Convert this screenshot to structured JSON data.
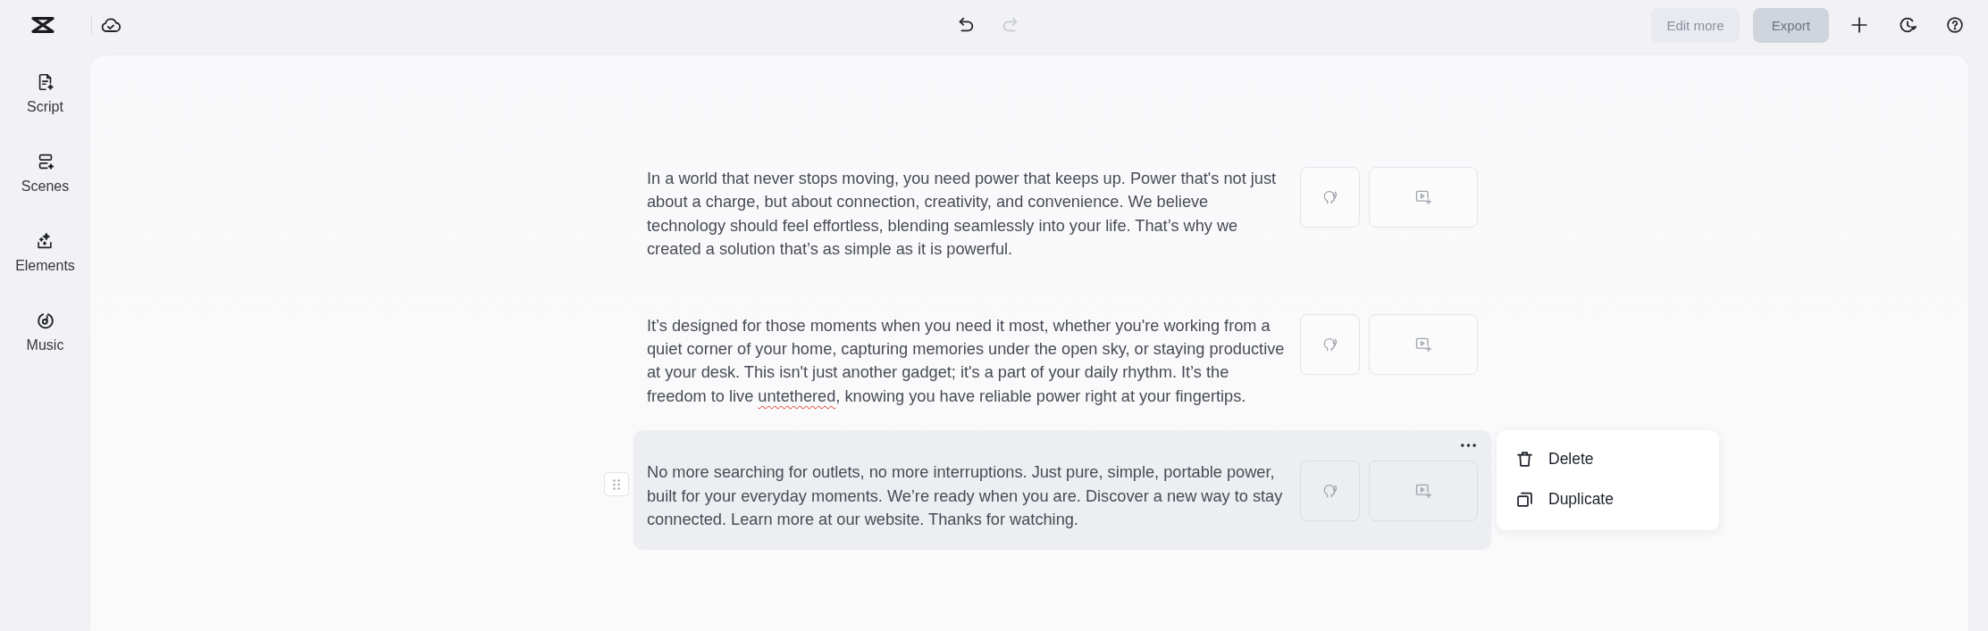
{
  "header": {
    "undo": {
      "disabled": false
    },
    "redo": {
      "disabled": true
    },
    "actions": [
      {
        "label": "Edit more",
        "kind": "edit",
        "disabled": true
      },
      {
        "label": "Export",
        "kind": "export",
        "disabled": true
      }
    ]
  },
  "sidebar": {
    "items": [
      {
        "label": "Script",
        "kind": "script",
        "selected": false
      },
      {
        "label": "Scenes",
        "kind": "scenes",
        "selected": false
      },
      {
        "label": "Elements",
        "kind": "elements",
        "selected": false
      },
      {
        "label": "Music",
        "kind": "music",
        "selected": false
      }
    ]
  },
  "script": {
    "paragraphs": [
      {
        "active": false,
        "segments": [
          {
            "text": "In a world that never stops moving, you need power that keeps up. Power that's not just about a charge, but about connection, creativity, and convenience. We believe technology should feel effortless, blending seamlessly into your life. That’s why we created a solution that’s as simple as it is powerful.",
            "misspelled": false
          }
        ]
      },
      {
        "active": false,
        "segments": [
          {
            "text": "It’s designed for those moments when you need it most, whether you're working from a quiet corner of your home, capturing memories under the open sky, or staying productive at your desk. This isn't just another gadget; it's a part of your daily rhythm. It’s the freedom to live ",
            "misspelled": false
          },
          {
            "text": "untethered",
            "misspelled": true
          },
          {
            "text": ", knowing you have reliable power right at your fingertips.",
            "misspelled": false
          }
        ]
      },
      {
        "active": true,
        "segments": [
          {
            "text": "No more searching for outlets, no more interruptions. Just pure, simple, portable power, built for your everyday moments. We’re ready when you are. Discover a new way to stay connected. Learn more at our website. Thanks for watching.",
            "misspelled": false
          }
        ]
      }
    ]
  },
  "context_menu": {
    "items": [
      {
        "label": "Delete",
        "kind": "delete"
      },
      {
        "label": "Duplicate",
        "kind": "duplicate"
      }
    ]
  }
}
